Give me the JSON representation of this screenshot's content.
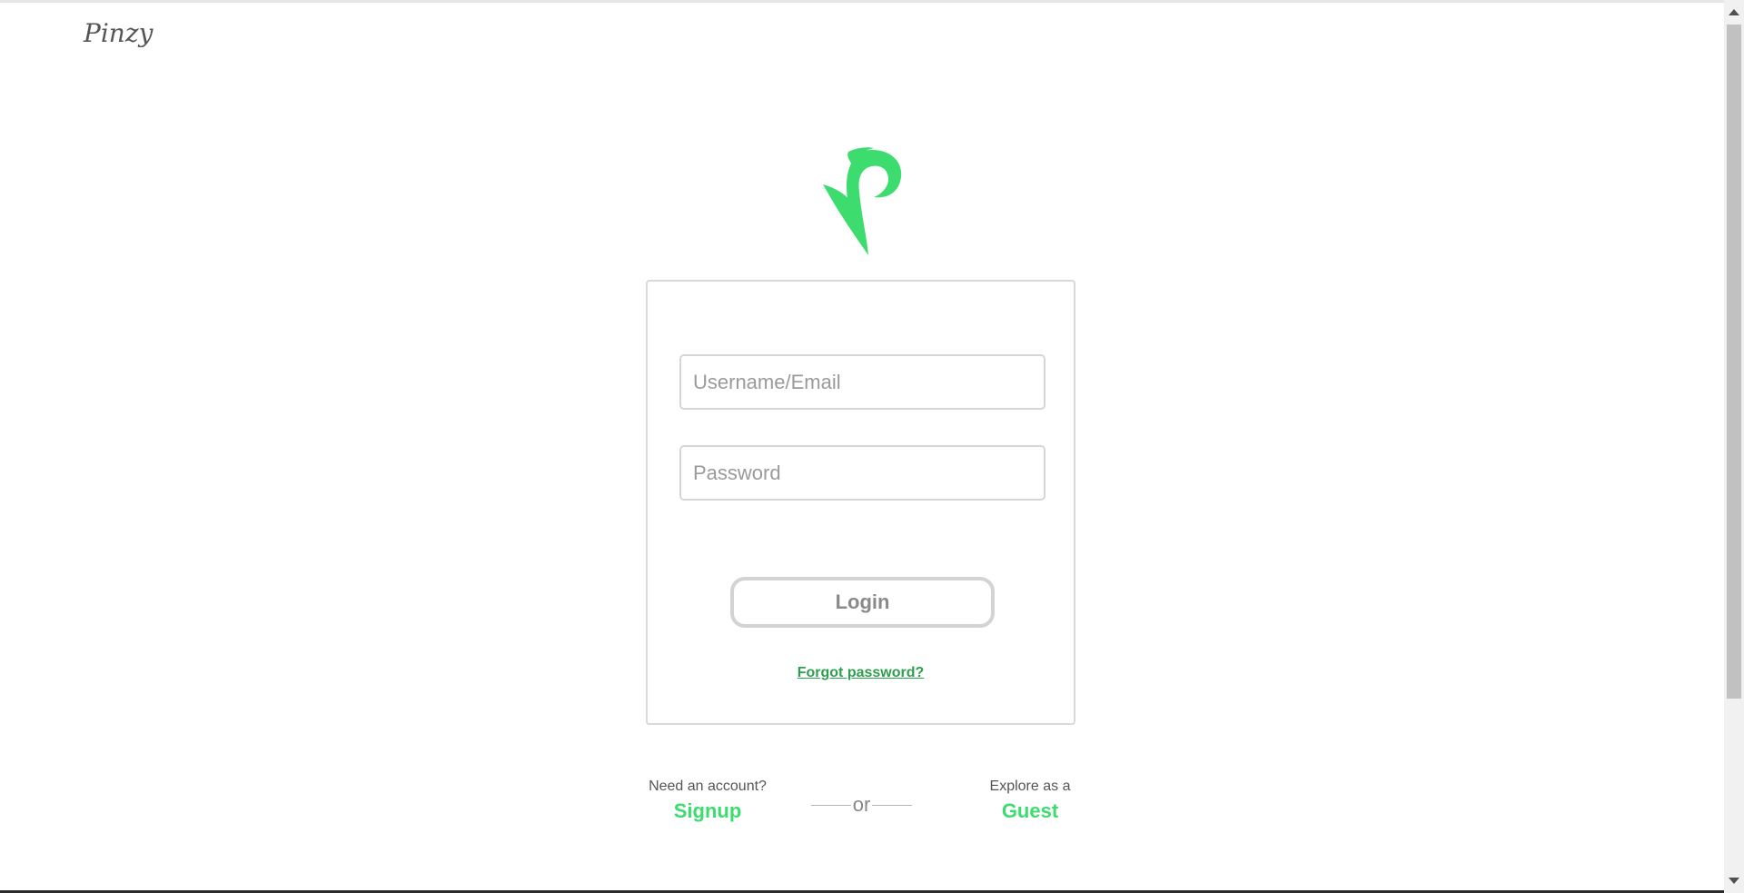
{
  "header": {
    "brand_name": "Pinzy"
  },
  "logo": {
    "icon": "pinzy-leaf-logo-icon",
    "color": "#3ddc6e"
  },
  "login_form": {
    "username_placeholder": "Username/Email",
    "username_value": "",
    "password_placeholder": "Password",
    "password_value": "",
    "login_label": "Login",
    "forgot_label": "Forgot password?"
  },
  "alternatives": {
    "signup_hint": "Need an account?",
    "signup_label": "Signup",
    "divider_text": "or",
    "guest_hint": "Explore as a",
    "guest_label": "Guest"
  },
  "colors": {
    "accent": "#3ddc6e",
    "link": "#2e9e4f",
    "border": "#d6d6d6"
  }
}
